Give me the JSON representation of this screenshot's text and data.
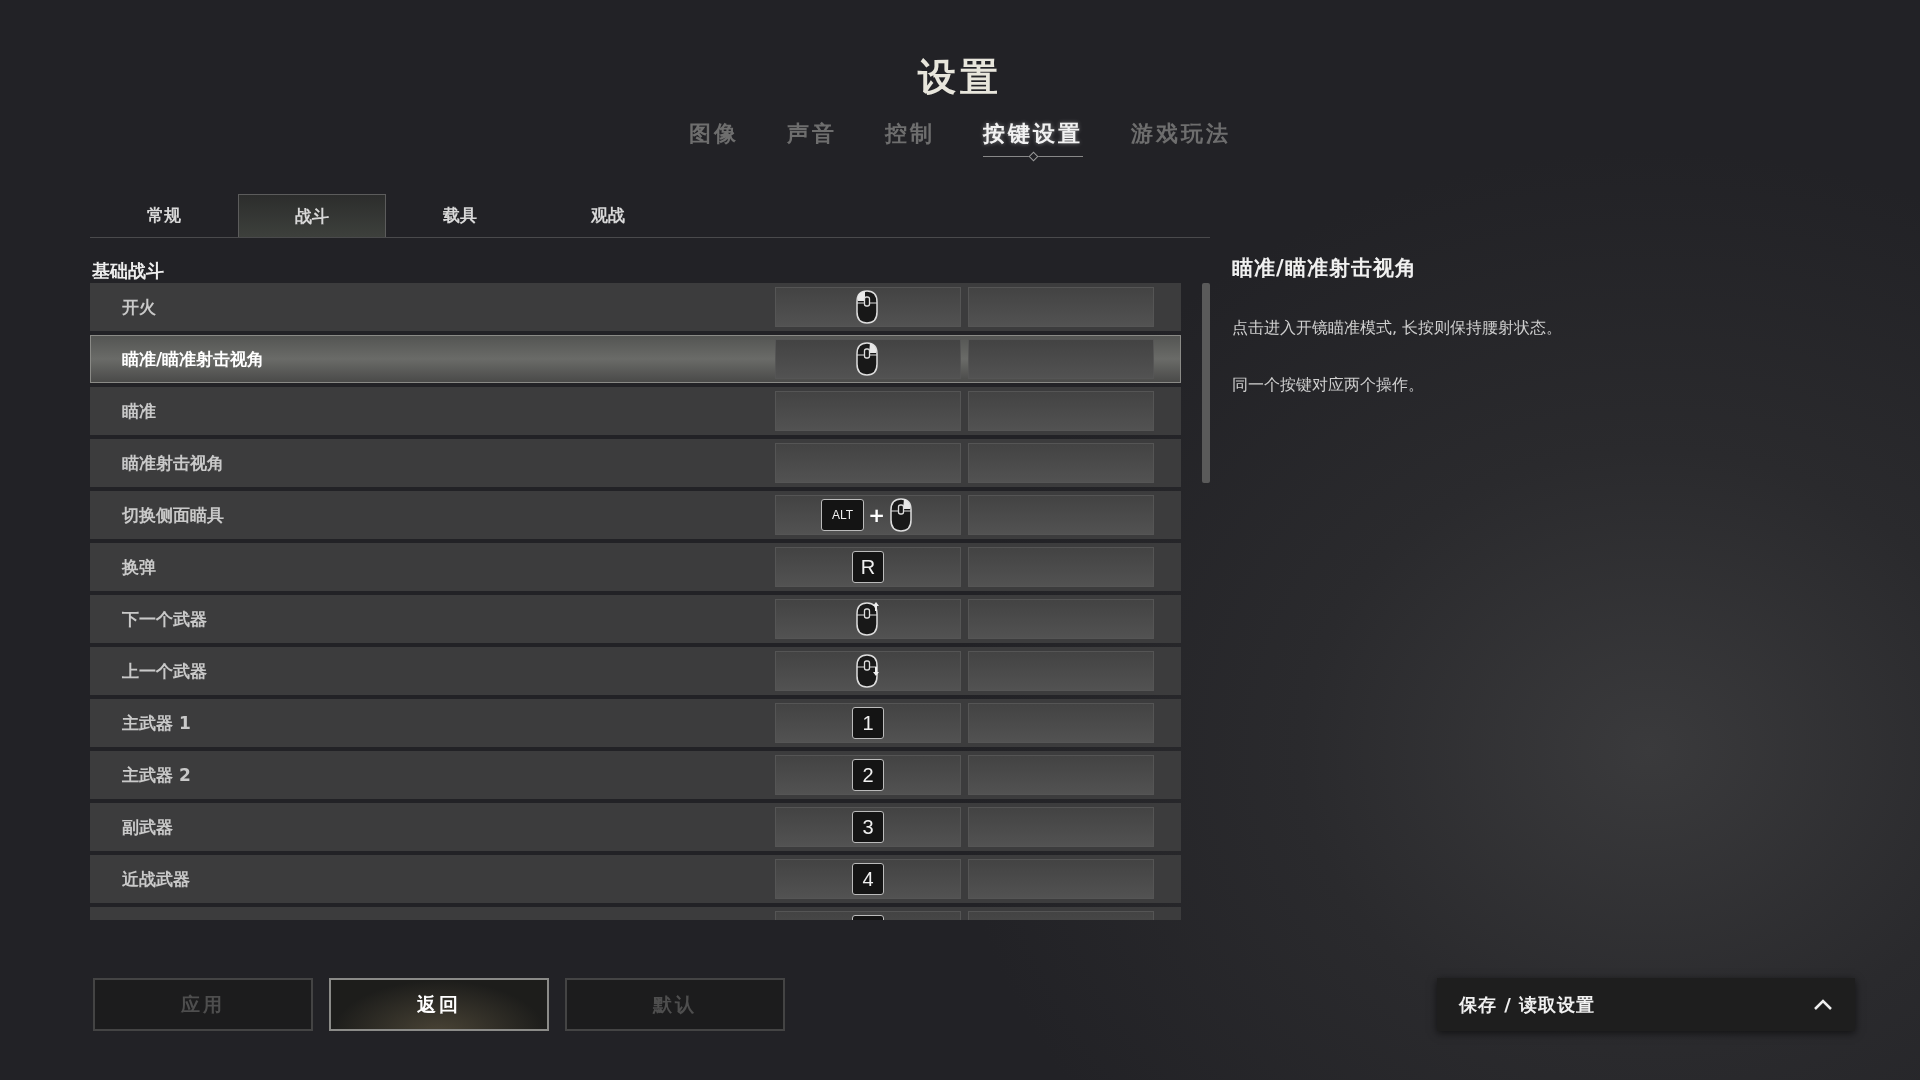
{
  "title": "设置",
  "main_tabs": [
    {
      "label": "图像",
      "selected": false
    },
    {
      "label": "声音",
      "selected": false
    },
    {
      "label": "控制",
      "selected": false
    },
    {
      "label": "按键设置",
      "selected": true
    },
    {
      "label": "游戏玩法",
      "selected": false
    }
  ],
  "sub_tabs": [
    {
      "label": "常规",
      "selected": false
    },
    {
      "label": "战斗",
      "selected": true
    },
    {
      "label": "载具",
      "selected": false
    },
    {
      "label": "观战",
      "selected": false
    }
  ],
  "section": "基础战斗",
  "rows": [
    {
      "label": "开火",
      "selected": false,
      "bindings": [
        {
          "kind": "mouse_left"
        }
      ]
    },
    {
      "label": "瞄准/瞄准射击视角",
      "selected": true,
      "bindings": [
        {
          "kind": "mouse_right"
        }
      ]
    },
    {
      "label": "瞄准",
      "selected": false,
      "bindings": []
    },
    {
      "label": "瞄准射击视角",
      "selected": false,
      "bindings": []
    },
    {
      "label": "切换侧面瞄具",
      "selected": false,
      "bindings": [
        {
          "kind": "combo_right",
          "key": "ALT",
          "plus": "+"
        }
      ]
    },
    {
      "label": "换弹",
      "selected": false,
      "bindings": [
        {
          "kind": "key",
          "key": "R"
        }
      ]
    },
    {
      "label": "下一个武器",
      "selected": false,
      "bindings": [
        {
          "kind": "wheel_up"
        }
      ]
    },
    {
      "label": "上一个武器",
      "selected": false,
      "bindings": [
        {
          "kind": "wheel_down"
        }
      ]
    },
    {
      "label": "主武器 1",
      "selected": false,
      "bindings": [
        {
          "kind": "key",
          "key": "1"
        }
      ]
    },
    {
      "label": "主武器 2",
      "selected": false,
      "bindings": [
        {
          "kind": "key",
          "key": "2"
        }
      ]
    },
    {
      "label": "副武器",
      "selected": false,
      "bindings": [
        {
          "kind": "key",
          "key": "3"
        }
      ]
    },
    {
      "label": "近战武器",
      "selected": false,
      "bindings": [
        {
          "kind": "key",
          "key": "4"
        }
      ]
    },
    {
      "selected": false,
      "bindings": [
        {
          "kind": "key"
        }
      ]
    }
  ],
  "detail": {
    "title": "瞄准/瞄准射击视角",
    "paragraphs": [
      "点击进入开镜瞄准模式, 长按则保持腰射状态。",
      "同一个按键对应两个操作。"
    ]
  },
  "buttons": [
    {
      "label": "应用",
      "disabled": true,
      "selected": false
    },
    {
      "label": "返回",
      "disabled": false,
      "selected": true
    },
    {
      "label": "默认",
      "disabled": true,
      "selected": false
    }
  ],
  "save_panel": {
    "label": "保存 / 读取设置",
    "expanded": false
  }
}
